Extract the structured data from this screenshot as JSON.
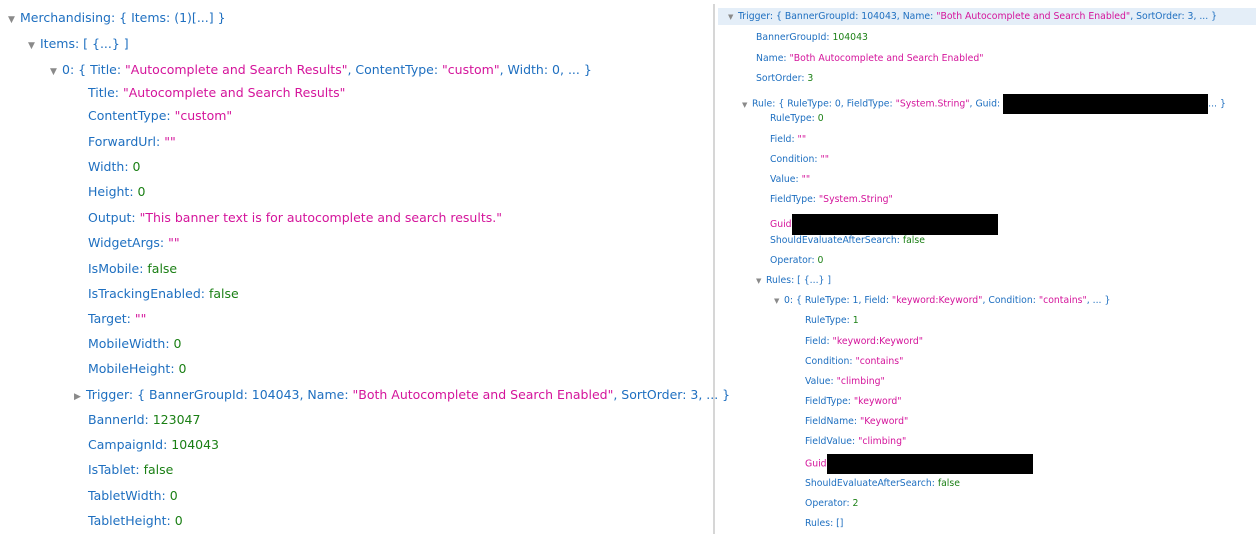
{
  "left": {
    "merch_summary": "Merchandising: { Items: (1)[...] }",
    "items_summary": "Items: [ {...} ]",
    "item0_prefix": "0: { Title: ",
    "item0_title_val": "\"Autocomplete and Search Results\"",
    "item0_mid": ", ContentType: ",
    "item0_ct_val": "\"custom\"",
    "item0_tail": ", Width: 0, ... }",
    "props": [
      {
        "key": "Title: ",
        "value": "\"Autocomplete and Search Results\""
      },
      {
        "key": "ContentType: ",
        "value": "\"custom\""
      },
      {
        "key": "ForwardUrl: ",
        "value": "\"\""
      },
      {
        "key": "Width: ",
        "value": "0"
      },
      {
        "key": "Height: ",
        "value": "0"
      },
      {
        "key": "Output: ",
        "value": "\"This banner text is for autocomplete and search results.\""
      },
      {
        "key": "WidgetArgs: ",
        "value": "\"\""
      },
      {
        "key": "IsMobile: ",
        "value": "false"
      },
      {
        "key": "IsTrackingEnabled: ",
        "value": "false"
      },
      {
        "key": "Target: ",
        "value": "\"\""
      },
      {
        "key": "MobileWidth: ",
        "value": "0"
      },
      {
        "key": "MobileHeight: ",
        "value": "0"
      }
    ],
    "trigger_prefix": "Trigger: { BannerGroupId: 104043, Name: ",
    "trigger_name": "\"Both Autocomplete and Search Enabled\"",
    "trigger_tail": ", SortOrder: 3, ... }",
    "props2": [
      {
        "key": "BannerId: ",
        "value": "123047"
      },
      {
        "key": "CampaignId: ",
        "value": "104043"
      },
      {
        "key": "IsTablet: ",
        "value": "false"
      },
      {
        "key": "TabletWidth: ",
        "value": "0"
      },
      {
        "key": "TabletHeight: ",
        "value": "0"
      }
    ]
  },
  "right": {
    "trigger_prefix": "Trigger: { BannerGroupId: 104043, Name: ",
    "trigger_name": "\"Both Autocomplete and Search Enabled\"",
    "trigger_tail": ", SortOrder: 3, ... }",
    "trigger_props": [
      {
        "key": "BannerGroupId: ",
        "value": "104043"
      },
      {
        "key": "Name: ",
        "value": "\"Both Autocomplete and Search Enabled\""
      },
      {
        "key": "SortOrder: ",
        "value": "3"
      }
    ],
    "rule_prefix": "Rule: { RuleType: 0, FieldType: ",
    "rule_fieldtype": "\"System.String\"",
    "rule_mid": ", Guid: ",
    "rule_tail": "... }",
    "rule_props": [
      {
        "key": "RuleType: ",
        "value": "0"
      },
      {
        "key": "Field: ",
        "value": "\"\""
      },
      {
        "key": "Condition: ",
        "value": "\"\""
      },
      {
        "key": "Value: ",
        "value": "\"\""
      },
      {
        "key": "FieldType: ",
        "value": "\"System.String\""
      },
      {
        "key": "Guid: ",
        "value": ""
      },
      {
        "key": "ShouldEvaluateAfterSearch: ",
        "value": "false"
      },
      {
        "key": "Operator: ",
        "value": "0"
      }
    ],
    "rules_summary": "Rules: [ {...} ]",
    "sub0_prefix": "0: { RuleType: 1, Field: ",
    "sub0_field": "\"keyword:Keyword\"",
    "sub0_mid": ", Condition: ",
    "sub0_cond": "\"contains\"",
    "sub0_tail": ", ... }",
    "sub_props": [
      {
        "key": "RuleType: ",
        "value": "1"
      },
      {
        "key": "Field: ",
        "value": "\"keyword:Keyword\""
      },
      {
        "key": "Condition: ",
        "value": "\"contains\""
      },
      {
        "key": "Value: ",
        "value": "\"climbing\""
      },
      {
        "key": "FieldType: ",
        "value": "\"keyword\""
      },
      {
        "key": "FieldName: ",
        "value": "\"Keyword\""
      },
      {
        "key": "FieldValue: ",
        "value": "\"climbing\""
      },
      {
        "key": "Guid: ",
        "value": ""
      },
      {
        "key": "ShouldEvaluateAfterSearch: ",
        "value": "false"
      },
      {
        "key": "Operator: ",
        "value": "2"
      },
      {
        "key": "Rules: ",
        "value": "[]"
      }
    ]
  }
}
